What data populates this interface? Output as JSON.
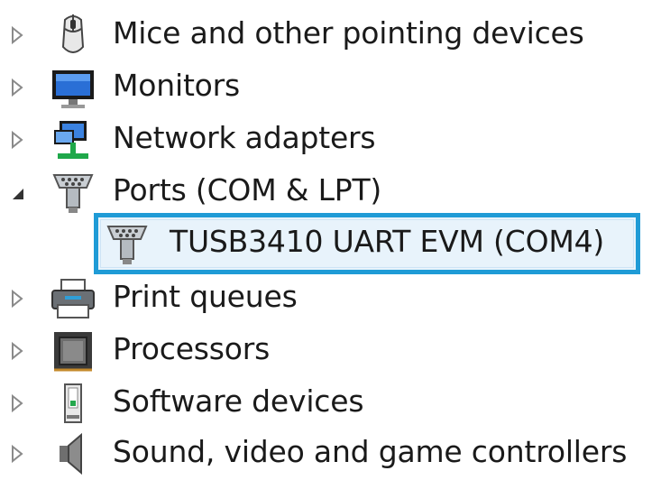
{
  "tree": {
    "items": [
      {
        "label": "Mice and other pointing devices",
        "icon": "mouse-icon",
        "state": "collapsed"
      },
      {
        "label": "Monitors",
        "icon": "monitor-icon",
        "state": "collapsed"
      },
      {
        "label": "Network adapters",
        "icon": "network-adapter-icon",
        "state": "collapsed"
      },
      {
        "label": "Ports (COM & LPT)",
        "icon": "port-connector-icon",
        "state": "expanded",
        "children": [
          {
            "label": "TUSB3410 UART EVM (COM4)",
            "icon": "port-connector-icon",
            "selected": true
          }
        ]
      },
      {
        "label": "Print queues",
        "icon": "printer-icon",
        "state": "collapsed"
      },
      {
        "label": "Processors",
        "icon": "processor-icon",
        "state": "collapsed"
      },
      {
        "label": "Software devices",
        "icon": "software-device-icon",
        "state": "collapsed"
      },
      {
        "label": "Sound, video and game controllers",
        "icon": "speaker-icon",
        "state": "collapsed"
      }
    ],
    "colors": {
      "selection_border": "#1f9bd6",
      "selection_fill": "#e8f3fb"
    }
  }
}
